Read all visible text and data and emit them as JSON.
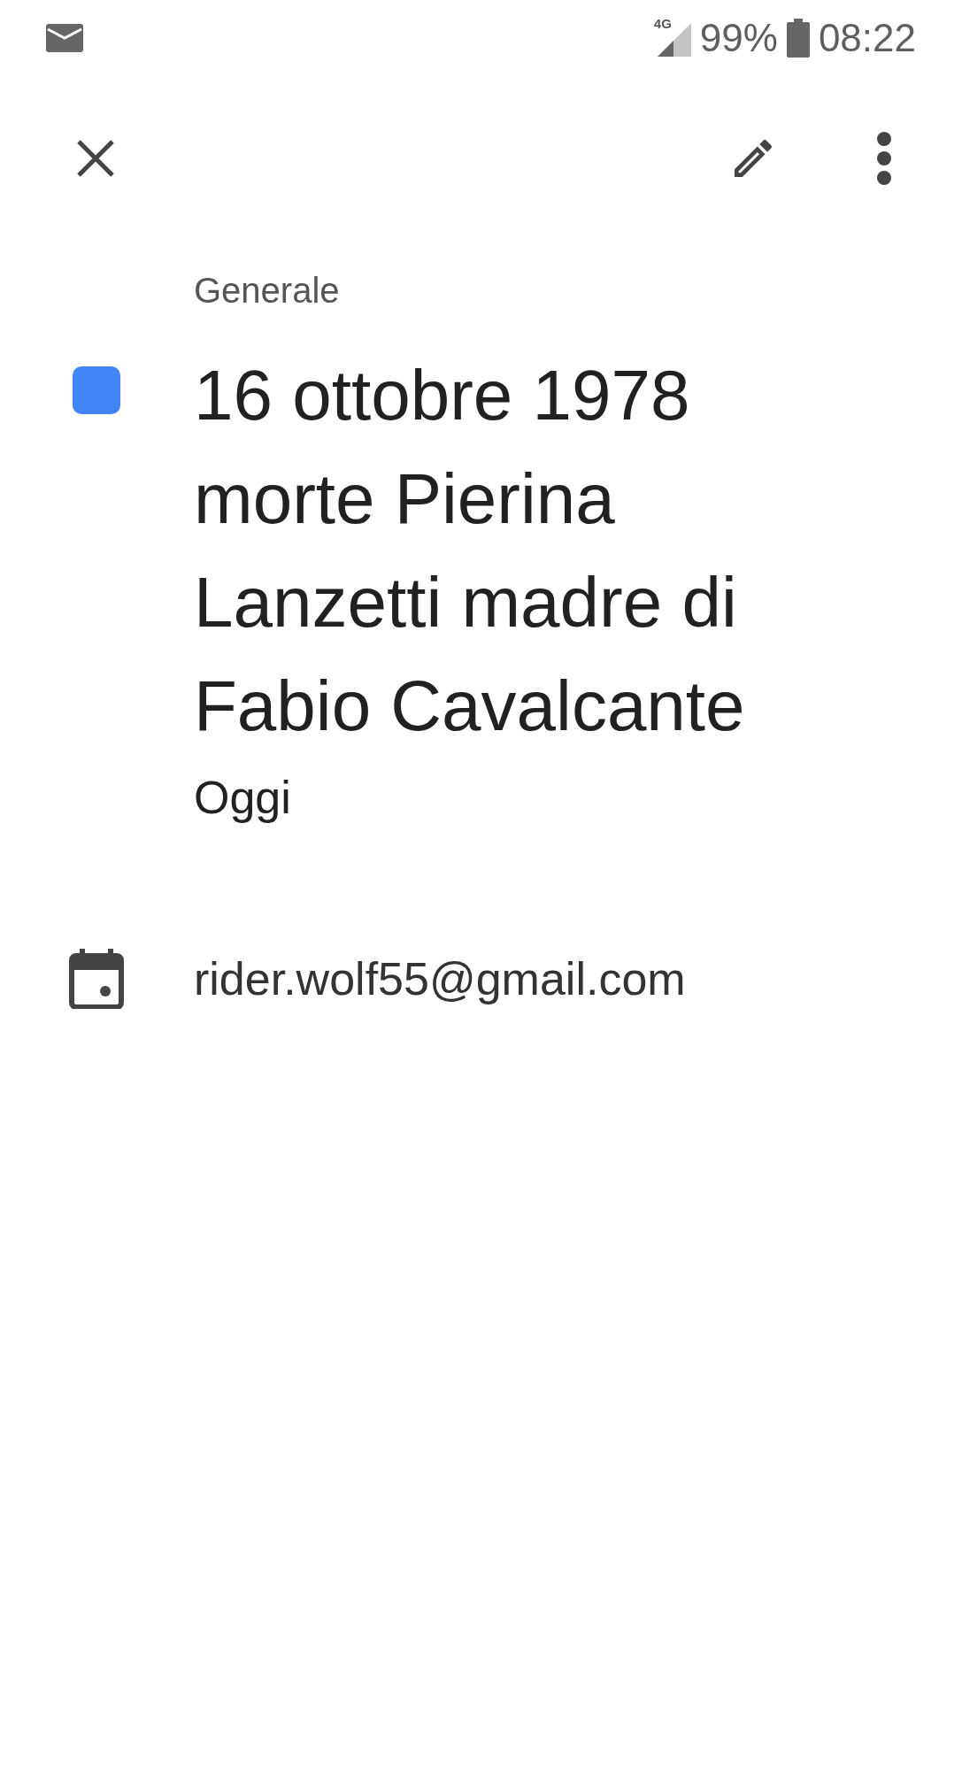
{
  "status_bar": {
    "network": "4G",
    "battery": "99%",
    "time": "08:22"
  },
  "event": {
    "calendar_name": "Generale",
    "color": "#4285f4",
    "title": "16 ottobre 1978 morte Pierina Lanzetti madre di Fabio Cavalcante",
    "date": "Oggi",
    "account": "rider.wolf55@gmail.com"
  }
}
